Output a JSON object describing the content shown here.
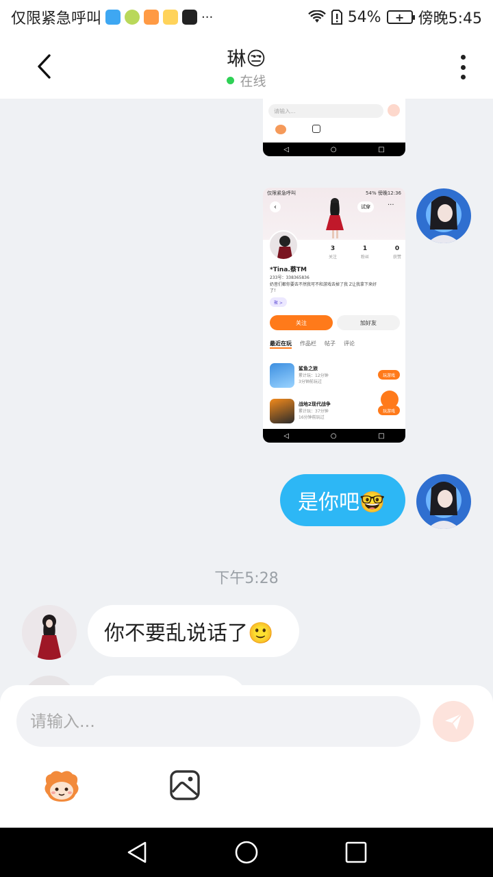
{
  "status_bar": {
    "carrier_text": "仅限紧急呼叫",
    "more": "···",
    "battery": "54%",
    "battery_icon_text": "+",
    "time": "傍晚5:45"
  },
  "header": {
    "title": "琳😒",
    "status": "在线"
  },
  "messages": {
    "screenshot_small": {
      "input_placeholder": "请输入..."
    },
    "screenshot_large": {
      "status_left": "仅限紧急呼叫",
      "status_right": "54% 傍晚12:36",
      "try_on": "试穿",
      "stats": [
        {
          "value": "3",
          "label": "关注"
        },
        {
          "value": "1",
          "label": "粉丝"
        },
        {
          "value": "0",
          "label": "获赞"
        }
      ],
      "name": "*Tina.蔡TM",
      "id_line": "233号：338365836",
      "bio": "奶昔们都你要去不然我可不和游戏去掉了我 Z让我拿下来好了！",
      "tag": "聚 >",
      "follow": "关注",
      "add_friend": "加好友",
      "tabs": [
        "最近在玩",
        "作品栏",
        "帖子",
        "评论"
      ],
      "games": [
        {
          "name": "鲨鱼之旅",
          "meta1": "累计玩：12分钟",
          "meta2": "3分钟前玩过",
          "play": "玩游戏"
        },
        {
          "name": "战地2现代战争",
          "meta1": "累计玩：37分钟",
          "meta2": "16分钟前玩过",
          "play": "玩游戏"
        }
      ]
    },
    "outgoing_text": "是你吧🤓",
    "timestamp": "下午5:28",
    "incoming_text": "你不要乱说话了🙂"
  },
  "input": {
    "placeholder": "请输入..."
  },
  "colors": {
    "accent_blue": "#2db7f5",
    "accent_orange": "#ff7a1a",
    "online_green": "#2fd156"
  }
}
